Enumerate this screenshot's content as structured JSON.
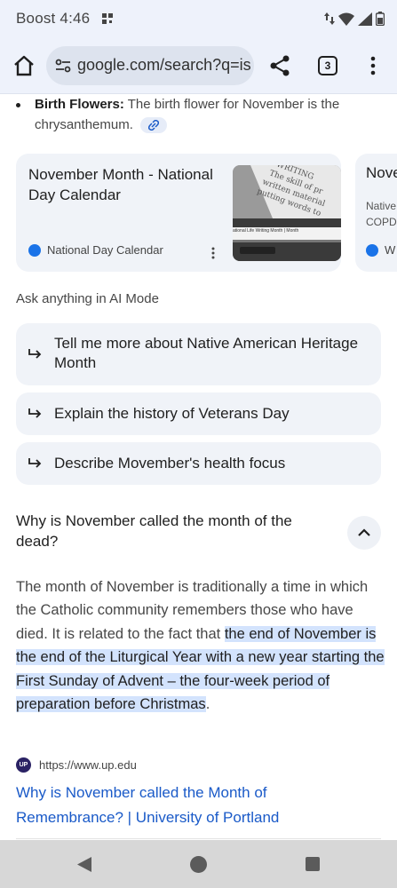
{
  "status_bar": {
    "carrier": "Boost",
    "time": "4:46"
  },
  "toolbar": {
    "url": "google.com/search?q=is",
    "tab_count": "3"
  },
  "bullet": {
    "label": "Birth Flowers:",
    "text": " The birth flower for November is the chrysanthemum."
  },
  "cards": [
    {
      "title": "November Month - National Day Calendar",
      "source": "National Day Calendar",
      "thumb_caption": "ational Life Writing Month | Month"
    },
    {
      "title": "Nove",
      "snippet_line1": "Native",
      "snippet_line2": "COPD",
      "source": "W"
    }
  ],
  "ask_section": {
    "label": "Ask anything in AI Mode",
    "suggestions": [
      {
        "line1": "Tell me more about Native American Heritage",
        "line2": "Month"
      },
      {
        "line1": "Explain the history of Veterans Day"
      },
      {
        "line1": "Describe Movember's health focus"
      }
    ]
  },
  "faq": {
    "question": "Why is November called the month of the dead?",
    "answer_plain": "The month of November is traditionally a time in which the Catholic community remembers those who have died. It is related to the fact that ",
    "answer_highlight": "the end of November is the end of the Liturgical Year with a new year starting the First Sunday of Advent – the four-week period of preparation before Christmas",
    "answer_end": ".",
    "source_logo": "UP",
    "source_url": "https://www.up.edu",
    "source_title": "Why is November called the Month of Remembrance? | University of Portland"
  }
}
